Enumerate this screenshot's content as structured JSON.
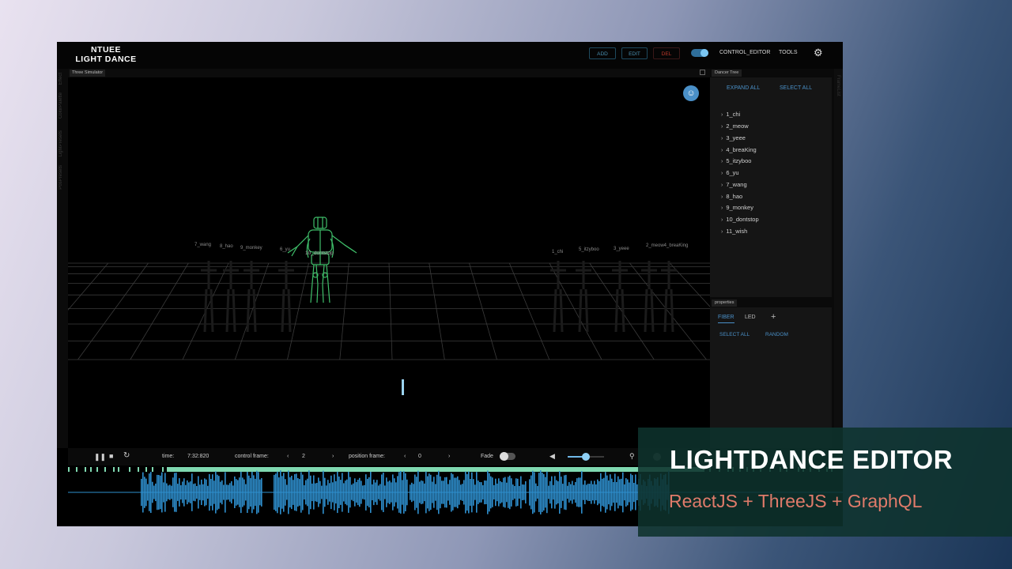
{
  "header": {
    "logo_line1": "NTUEE",
    "logo_line2": "LIGHT DANCE",
    "add_label": "ADD",
    "edit_label": "EDIT",
    "del_label": "DEL",
    "control_editor_label": "CONTROL_EDITOR",
    "tools_label": "TOOLS"
  },
  "left_tabs": [
    "Effect",
    "ColorPalette",
    "LightPresets",
    "PosPresets"
  ],
  "simulator": {
    "tab_title": "Three Simulator",
    "dancer_labels": {
      "wang": "7_wang",
      "hao": "8_hao",
      "monkey": "9_monkey",
      "yu": "6_yu",
      "dontstop": "10_dontstop",
      "chi": "1_chi",
      "itzyboo": "5_itzyboo",
      "yeee": "3_yeee",
      "meow_break": "2_meow4_breaKing"
    }
  },
  "dancer_tree": {
    "tab_title": "Dancer Tree",
    "expand_all": "EXPAND ALL",
    "select_all": "SELECT ALL",
    "dancers": [
      "1_chi",
      "2_meow",
      "3_yeee",
      "4_breaKing",
      "5_itzyboo",
      "6_yu",
      "7_wang",
      "8_hao",
      "9_monkey",
      "10_dontstop",
      "11_wish"
    ]
  },
  "right_side_tab": "FrameList",
  "properties": {
    "tab_title": "properties",
    "tabs": [
      "FIBER",
      "LED"
    ],
    "add_symbol": "+",
    "select_all": "SELECT ALL",
    "random": "RANDOM"
  },
  "controls": {
    "time_label": "time:",
    "time_value": "7:32:820",
    "control_frame_label": "control frame:",
    "control_frame_value": "2",
    "position_frame_label": "position frame:",
    "position_frame_value": "0",
    "fade_label": "Fade",
    "volume_level": 0.5
  },
  "overlay": {
    "title": "LIGHTDANCE EDITOR",
    "subtitle": "ReactJS + ThreeJS + GraphQL"
  },
  "colors": {
    "accent_blue": "#4a90c8",
    "waveform_blue": "#2e8fce",
    "marker_green": "#7fd8b0",
    "dancer_green": "#3fbf6a",
    "del_red": "#c0392b",
    "overlay_bg": "#0e322c",
    "overlay_sub": "#e07b6a"
  }
}
